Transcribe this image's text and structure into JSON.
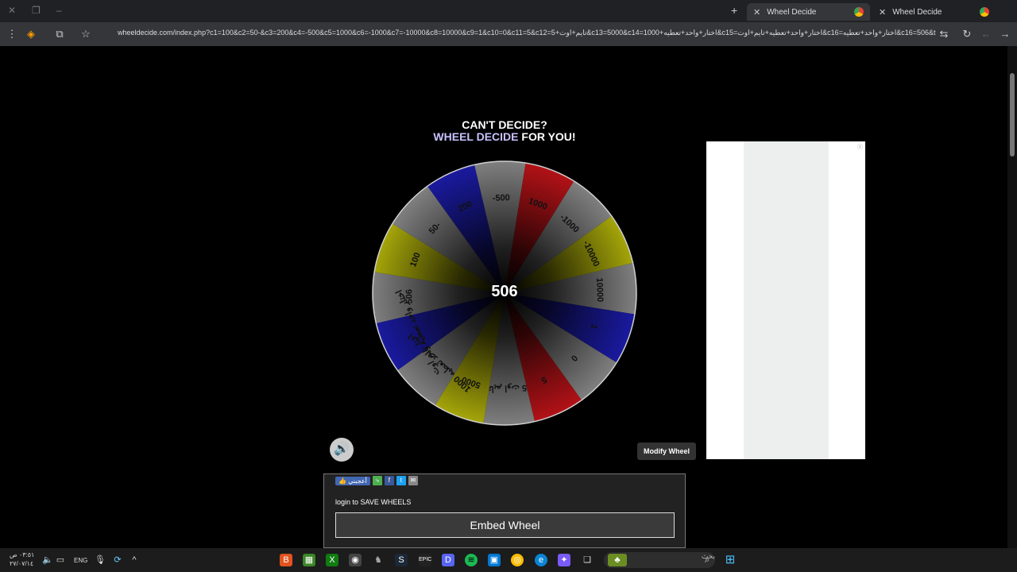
{
  "browser": {
    "tabs": [
      {
        "title": "Wheel Decide",
        "active": true
      },
      {
        "title": "Wheel Decide",
        "active": false
      }
    ],
    "url": "wheeldecide.com/index.php?c1=100&c2=50-&c3=200&c4=-500&c5=1000&c6=-1000&c7=-10000&c8=10000&c9=1&c10=0&c11=5&c12=5+تایم+اوت&c13=5000&c14=1000+اختار+واحد+تعطیه&c15=اختار+واحد+تعطیه+تایم+اوت&c16=اختار+واحد+تعطیه&c16=506&time=5"
  },
  "header": {
    "line1": "CAN'T DECIDE?",
    "accent": "WHEEL DECIDE",
    "line2_rest": " FOR YOU!"
  },
  "wheel": {
    "result": "506",
    "segments": [
      {
        "label": "-500",
        "color": "#808080"
      },
      {
        "label": "1000",
        "color": "#b31217"
      },
      {
        "label": "-1000",
        "color": "#808080"
      },
      {
        "label": "-10000",
        "color": "#a6a60a"
      },
      {
        "label": "10000",
        "color": "#808080"
      },
      {
        "label": "1",
        "color": "#1a1aa0"
      },
      {
        "label": "0",
        "color": "#808080"
      },
      {
        "label": "5",
        "color": "#b31217"
      },
      {
        "label": "5 تایم اوت",
        "color": "#808080"
      },
      {
        "label": "5000",
        "color": "#a6a60a"
      },
      {
        "label": "1000 اختار واحد تعطیه",
        "color": "#808080"
      },
      {
        "label": "اختار واحد تعطیه تایم اوت",
        "color": "#1a1aa0"
      },
      {
        "label": "506",
        "color": "#808080"
      },
      {
        "label": "100",
        "color": "#a6a60a"
      },
      {
        "label": "50-",
        "color": "#808080"
      },
      {
        "label": "200",
        "color": "#1a1aa0"
      }
    ]
  },
  "controls": {
    "modify_label": "Modify Wheel",
    "login_text": "login to SAVE WHEELS",
    "embed_label": "Embed Wheel",
    "like_label": "أعجبني"
  },
  "taskbar": {
    "time": "٠٣:٥١ ص",
    "date": "٢٧/٠٧/١٤",
    "lang": "ENG",
    "search_placeholder": "بحث"
  }
}
